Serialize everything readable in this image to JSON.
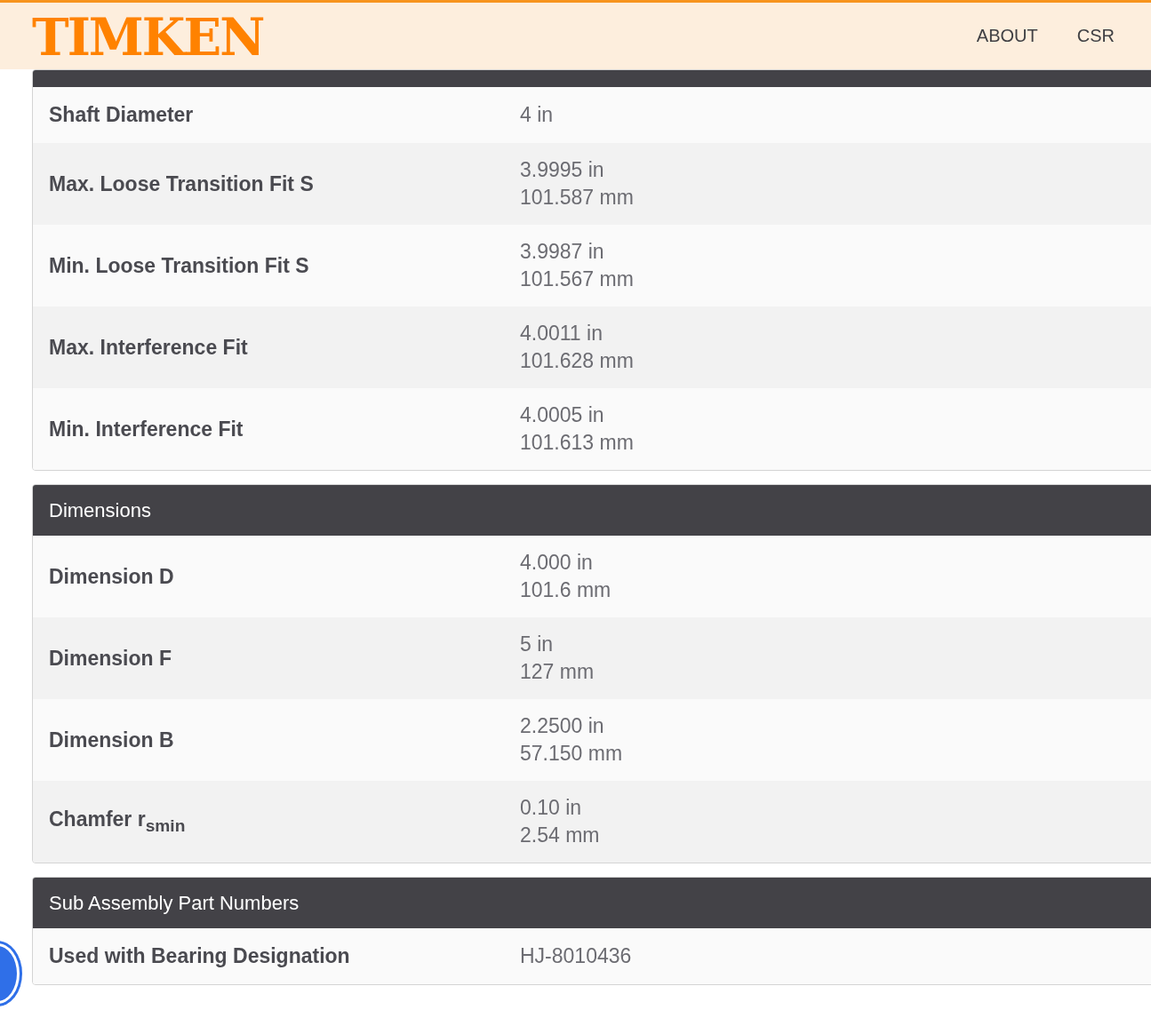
{
  "header": {
    "logo": "TIMKEN",
    "nav": [
      "ABOUT",
      "CSR"
    ]
  },
  "sections": [
    {
      "rows": [
        {
          "label": "Shaft Diameter",
          "values": [
            "4 in"
          ]
        },
        {
          "label": "Max. Loose Transition Fit S",
          "values": [
            "3.9995 in",
            "101.587 mm"
          ]
        },
        {
          "label": "Min. Loose Transition Fit S",
          "values": [
            "3.9987 in",
            "101.567 mm"
          ]
        },
        {
          "label": "Max. Interference Fit",
          "values": [
            "4.0011 in",
            "101.628 mm"
          ]
        },
        {
          "label": "Min. Interference Fit",
          "values": [
            "4.0005 in",
            "101.613 mm"
          ]
        }
      ]
    },
    {
      "title": "Dimensions",
      "rows": [
        {
          "label": "Dimension D",
          "values": [
            "4.000 in",
            "101.6 mm"
          ]
        },
        {
          "label": "Dimension F",
          "values": [
            "5 in",
            "127 mm"
          ]
        },
        {
          "label": "Dimension B",
          "values": [
            "2.2500 in",
            "57.150 mm"
          ]
        },
        {
          "label": "Chamfer r$_{smin}$",
          "values": [
            "0.10 in",
            "2.54 mm"
          ]
        }
      ]
    },
    {
      "title": "Sub Assembly Part Numbers",
      "rows": [
        {
          "label": "Used with Bearing Designation",
          "values": [
            "HJ-8010436"
          ]
        }
      ]
    }
  ]
}
